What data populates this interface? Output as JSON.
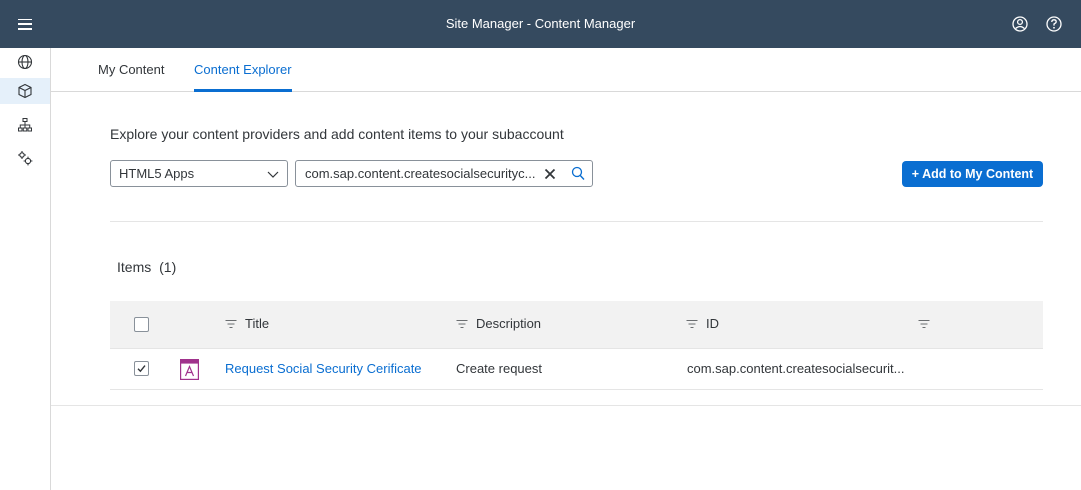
{
  "shell": {
    "title": "Site Manager - Content Manager",
    "icons": [
      "menu-icon",
      "user-icon",
      "help-icon"
    ],
    "bg_color": "#354a5f"
  },
  "sidenav": {
    "items": [
      {
        "icon": "globe-icon",
        "selected": false
      },
      {
        "icon": "cube-icon",
        "selected": true
      },
      {
        "icon": "sitemap-icon",
        "selected": false
      },
      {
        "icon": "settings-icon",
        "selected": false
      }
    ]
  },
  "tabs": [
    {
      "label": "My Content",
      "active": false
    },
    {
      "label": "Content Explorer",
      "active": true
    }
  ],
  "explorer": {
    "intro": "Explore your content providers and add content items to your subaccount",
    "provider_select": {
      "value": "HTML5 Apps"
    },
    "search": {
      "value": "com.sap.content.createsocialsecurityc..."
    },
    "add_button": "+ Add to My Content"
  },
  "items": {
    "title": "Items",
    "count": "(1)",
    "columns": [
      "Title",
      "Description",
      "ID",
      ""
    ],
    "rows": [
      {
        "checked": true,
        "icon": "app-icon",
        "title": "Request Social Security Cerificate",
        "description": "Create request",
        "id": "com.sap.content.createsocialsecurit..."
      }
    ]
  },
  "colors": {
    "accent": "#0a6ed1",
    "app_icon": "#a0328c"
  }
}
